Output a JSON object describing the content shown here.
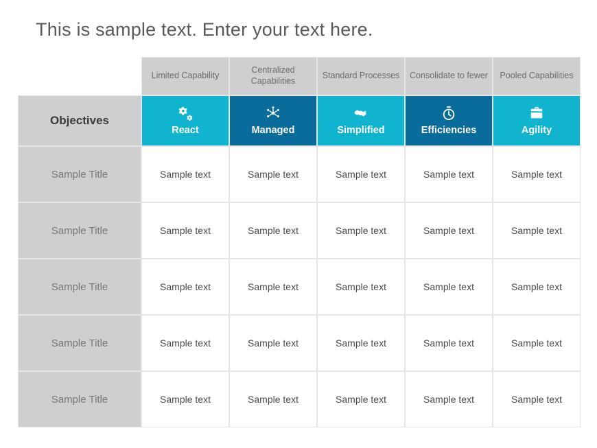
{
  "title": "This is sample text. Enter your text here.",
  "objectives_header": "Objectives",
  "columns": [
    {
      "top": "Limited Capability",
      "stage": "React",
      "icon": "gears-icon"
    },
    {
      "top": "Centralized Capabilities",
      "stage": "Managed",
      "icon": "network-icon"
    },
    {
      "top": "Standard Processes",
      "stage": "Simplified",
      "icon": "handshake-icon"
    },
    {
      "top": "Consolidate to fewer",
      "stage": "Efficiencies",
      "icon": "stopwatch-icon"
    },
    {
      "top": "Pooled Capabilities",
      "stage": "Agility",
      "icon": "briefcase-icon"
    }
  ],
  "rows": [
    {
      "title": "Sample Title",
      "cells": [
        "Sample text",
        "Sample text",
        "Sample text",
        "Sample text",
        "Sample text"
      ]
    },
    {
      "title": "Sample Title",
      "cells": [
        "Sample text",
        "Sample text",
        "Sample text",
        "Sample text",
        "Sample text"
      ]
    },
    {
      "title": "Sample Title",
      "cells": [
        "Sample text",
        "Sample text",
        "Sample text",
        "Sample text",
        "Sample text"
      ]
    },
    {
      "title": "Sample Title",
      "cells": [
        "Sample text",
        "Sample text",
        "Sample text",
        "Sample text",
        "Sample text"
      ]
    },
    {
      "title": "Sample Title",
      "cells": [
        "Sample text",
        "Sample text",
        "Sample text",
        "Sample text",
        "Sample text"
      ]
    }
  ],
  "colors": {
    "teal": "#10b4cf",
    "darkblue": "#0a6c9b",
    "gray": "#cfcfcf"
  }
}
